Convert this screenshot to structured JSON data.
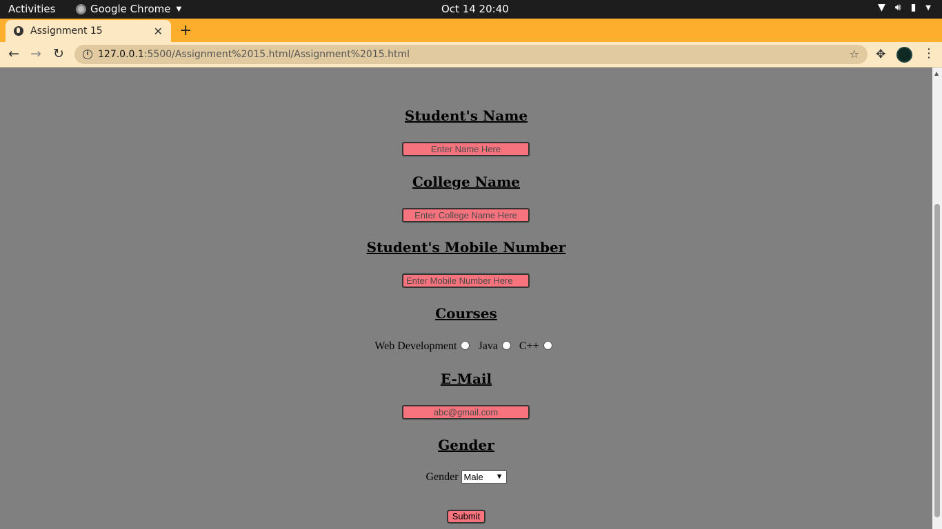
{
  "system_bar": {
    "activities": "Activities",
    "app_name": "Google Chrome",
    "datetime": "Oct 14  20:40"
  },
  "browser": {
    "tab_title": "Assignment 15",
    "url_host": "127.0.0.1",
    "url_rest": ":5500/Assignment%2015.html/Assignment%2015.html"
  },
  "form": {
    "student_name_heading": "Student's Name",
    "student_name_placeholder": "Enter Name Here",
    "college_heading": "College Name",
    "college_placeholder": "Enter College Name Here",
    "mobile_heading": "Student's Mobile Number",
    "mobile_placeholder": "Enter Mobile Number Here",
    "courses_heading": "Courses",
    "courses": [
      "Web Development",
      "Java",
      "C++"
    ],
    "email_heading": "E-Mail",
    "email_placeholder": "abc@gmail.com",
    "gender_heading": "Gender",
    "gender_label": "Gender",
    "gender_selected": "Male",
    "submit_label": "Submit"
  },
  "colors": {
    "page_bg": "#808080",
    "input_bg": "#f7737d",
    "tabstrip": "#fdae2c"
  }
}
